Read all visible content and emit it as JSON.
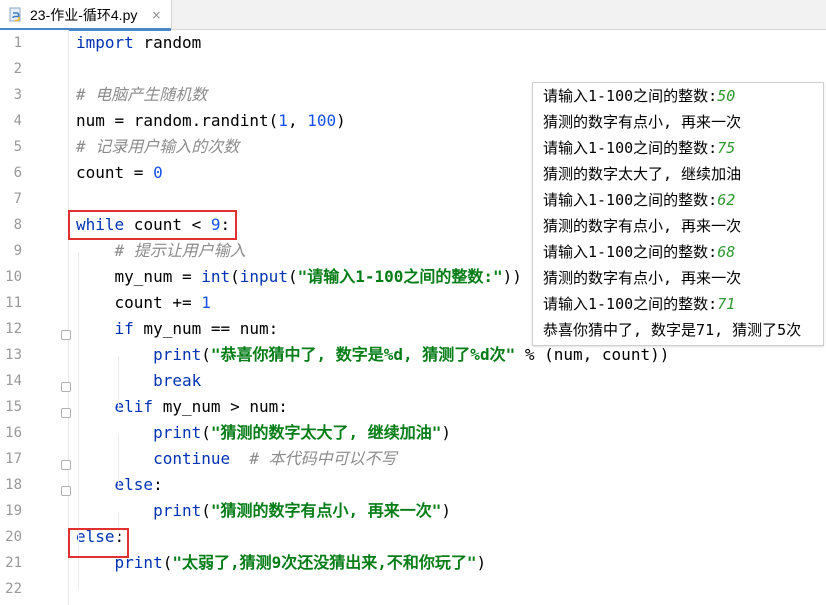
{
  "tab": {
    "title": "23-作业-循环4.py",
    "close": "×",
    "icon": "python-file-icon"
  },
  "colors": {
    "keyword": "#0033b3",
    "number": "#1750eb",
    "string": "#067d17",
    "comment": "#8c8c8c",
    "highlight_box": "#e03030",
    "input_value": "#2e9a2e"
  },
  "lines": [
    {
      "n": "1",
      "segs": [
        {
          "c": "kw",
          "t": "import"
        },
        {
          "c": "",
          "t": " random"
        }
      ]
    },
    {
      "n": "2",
      "segs": []
    },
    {
      "n": "3",
      "segs": [
        {
          "c": "cmt",
          "t": "# 电脑产生随机数"
        }
      ]
    },
    {
      "n": "4",
      "segs": [
        {
          "c": "",
          "t": "num = random.randint("
        },
        {
          "c": "num",
          "t": "1"
        },
        {
          "c": "",
          "t": ", "
        },
        {
          "c": "num",
          "t": "100"
        },
        {
          "c": "",
          "t": ")"
        }
      ]
    },
    {
      "n": "5",
      "segs": [
        {
          "c": "cmt",
          "t": "# 记录用户输入的次数"
        }
      ]
    },
    {
      "n": "6",
      "segs": [
        {
          "c": "",
          "t": "count = "
        },
        {
          "c": "num",
          "t": "0"
        }
      ]
    },
    {
      "n": "7",
      "segs": []
    },
    {
      "n": "8",
      "segs": [
        {
          "c": "kw",
          "t": "while"
        },
        {
          "c": "",
          "t": " count < "
        },
        {
          "c": "num",
          "t": "9"
        },
        {
          "c": "",
          "t": ":"
        }
      ]
    },
    {
      "n": "9",
      "segs": [
        {
          "c": "",
          "t": "    "
        },
        {
          "c": "cmt",
          "t": "# 提示让用户输入"
        }
      ]
    },
    {
      "n": "10",
      "segs": [
        {
          "c": "",
          "t": "    my_num = "
        },
        {
          "c": "kw",
          "t": "int"
        },
        {
          "c": "",
          "t": "("
        },
        {
          "c": "kw",
          "t": "input"
        },
        {
          "c": "",
          "t": "("
        },
        {
          "c": "str",
          "t": "\"请输入1-100之间的整数:\""
        },
        {
          "c": "",
          "t": "))"
        }
      ]
    },
    {
      "n": "11",
      "segs": [
        {
          "c": "",
          "t": "    count += "
        },
        {
          "c": "num",
          "t": "1"
        }
      ]
    },
    {
      "n": "12",
      "segs": [
        {
          "c": "",
          "t": "    "
        },
        {
          "c": "kw",
          "t": "if"
        },
        {
          "c": "",
          "t": " my_num == num:"
        }
      ]
    },
    {
      "n": "13",
      "segs": [
        {
          "c": "",
          "t": "        "
        },
        {
          "c": "kw",
          "t": "print"
        },
        {
          "c": "",
          "t": "("
        },
        {
          "c": "str",
          "t": "\"恭喜你猜中了, 数字是%d, 猜测了%d次\""
        },
        {
          "c": "",
          "t": " % (num, count))"
        }
      ]
    },
    {
      "n": "14",
      "segs": [
        {
          "c": "",
          "t": "        "
        },
        {
          "c": "kw",
          "t": "break"
        }
      ]
    },
    {
      "n": "15",
      "segs": [
        {
          "c": "",
          "t": "    "
        },
        {
          "c": "kw",
          "t": "elif"
        },
        {
          "c": "",
          "t": " my_num > num:"
        }
      ]
    },
    {
      "n": "16",
      "segs": [
        {
          "c": "",
          "t": "        "
        },
        {
          "c": "kw",
          "t": "print"
        },
        {
          "c": "",
          "t": "("
        },
        {
          "c": "str",
          "t": "\"猜测的数字太大了, 继续加油\""
        },
        {
          "c": "",
          "t": ")"
        }
      ]
    },
    {
      "n": "17",
      "segs": [
        {
          "c": "",
          "t": "        "
        },
        {
          "c": "kw",
          "t": "continue"
        },
        {
          "c": "",
          "t": "  "
        },
        {
          "c": "cmt",
          "t": "# 本代码中可以不写"
        }
      ]
    },
    {
      "n": "18",
      "segs": [
        {
          "c": "",
          "t": "    "
        },
        {
          "c": "kw",
          "t": "else"
        },
        {
          "c": "",
          "t": ":"
        }
      ]
    },
    {
      "n": "19",
      "segs": [
        {
          "c": "",
          "t": "        "
        },
        {
          "c": "kw",
          "t": "print"
        },
        {
          "c": "",
          "t": "("
        },
        {
          "c": "str",
          "t": "\"猜测的数字有点小, 再来一次\""
        },
        {
          "c": "",
          "t": ")"
        }
      ]
    },
    {
      "n": "20",
      "segs": [
        {
          "c": "kw",
          "t": "else"
        },
        {
          "c": "",
          "t": ":"
        }
      ]
    },
    {
      "n": "21",
      "segs": [
        {
          "c": "",
          "t": "    "
        },
        {
          "c": "kw",
          "t": "print"
        },
        {
          "c": "",
          "t": "("
        },
        {
          "c": "str",
          "t": "\"太弱了,猜测9次还没猜出来,不和你玩了\""
        },
        {
          "c": "",
          "t": ")"
        }
      ]
    },
    {
      "n": "22",
      "segs": []
    }
  ],
  "output": [
    {
      "text": "请输入1-100之间的整数:",
      "input": "50"
    },
    {
      "text": "猜测的数字有点小, 再来一次",
      "input": ""
    },
    {
      "text": "请输入1-100之间的整数:",
      "input": "75"
    },
    {
      "text": "猜测的数字太大了, 继续加油",
      "input": ""
    },
    {
      "text": "请输入1-100之间的整数:",
      "input": "62"
    },
    {
      "text": "猜测的数字有点小, 再来一次",
      "input": ""
    },
    {
      "text": "请输入1-100之间的整数:",
      "input": "68"
    },
    {
      "text": "猜测的数字有点小, 再来一次",
      "input": ""
    },
    {
      "text": "请输入1-100之间的整数:",
      "input": "71"
    },
    {
      "text": "恭喜你猜中了, 数字是71, 猜测了5次",
      "input": ""
    }
  ]
}
